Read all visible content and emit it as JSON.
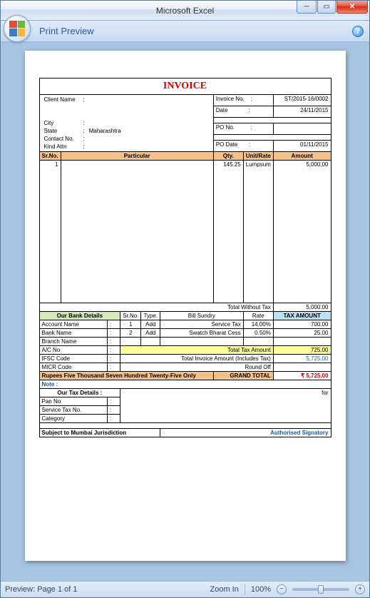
{
  "window": {
    "title": "Microsoft Excel"
  },
  "ribbon": {
    "tab": "Print Preview"
  },
  "statusbar": {
    "preview": "Preview: Page 1 of 1",
    "zoom_in": "Zoom In",
    "zoom_pct": "100%",
    "minus": "−",
    "plus": "+"
  },
  "invoice": {
    "title": "INVOICE",
    "labels": {
      "client_name": "Client Name",
      "city": "City",
      "state": "State",
      "contact_no": "Contact No.",
      "kind_attn": "Kind Attn",
      "invoice_no": "Invoice No.",
      "date": "Date",
      "po_no": "PO No.",
      "po_date": "PO Date",
      "col_srno": "Sr.No.",
      "col_particular": "Particular",
      "col_qty": "Qty.",
      "col_rate": "Unit/Rate",
      "col_amount": "Amount",
      "total_without_tax": "Total Without Tax",
      "bank_header": "Our Bank Details",
      "account_name": "Account Name",
      "bank_name": "Bank Name",
      "branch_name": "Branch Name",
      "ac_no": "A/C No",
      "ifsc": "IFSC Code",
      "micr": "MICR Code",
      "bs_srno": "Sr.No.",
      "bs_type": "Type.",
      "bs_sundry": "Bill Sundry",
      "bs_rate": "Rate",
      "bs_taxamt": "TAX AMOUNT",
      "total_tax": "Total Tax Amount",
      "total_invoice": "Total Invoice Amount (Includes Tax)",
      "round_off": "Round Off",
      "grand_total": "GRAND TOTAL",
      "note": "Note :",
      "tax_header": "Our Tax Details :",
      "pan_no": "Pan No",
      "service_tax_no": "Service Tax No.",
      "category": "Category",
      "for": "for",
      "auth_sig": "Authorised Signatory",
      "jurisdiction": "Subject to Mumbai Jurisdiction"
    },
    "header": {
      "client_name": "",
      "city": "",
      "state": "Maharashtra",
      "contact_no": "",
      "kind_attn": "",
      "invoice_no": "ST/2015-16/0002",
      "date": "24/11/2015",
      "po_no": "",
      "po_date": "01/11/2015"
    },
    "items": [
      {
        "srno": "1",
        "particular": "",
        "qty": "145.25",
        "rate": "Lumpsum",
        "amount": "5,000.00"
      }
    ],
    "total_without_tax": "5,000.00",
    "bill_sundry": [
      {
        "srno": "1",
        "type": "Add",
        "name": "Service Tax",
        "rate": "14.00%",
        "amount": "700.00"
      },
      {
        "srno": "2",
        "type": "Add",
        "name": "Swatch Bharat Cess",
        "rate": "0.50%",
        "amount": "25.00"
      }
    ],
    "total_tax": "725.00",
    "total_invoice": "5,725.00",
    "round_off": "",
    "grand_total": "₹ 5,725.00",
    "in_words": "Rupees Five Thousand Seven Hundred Twenty-Five Only"
  }
}
